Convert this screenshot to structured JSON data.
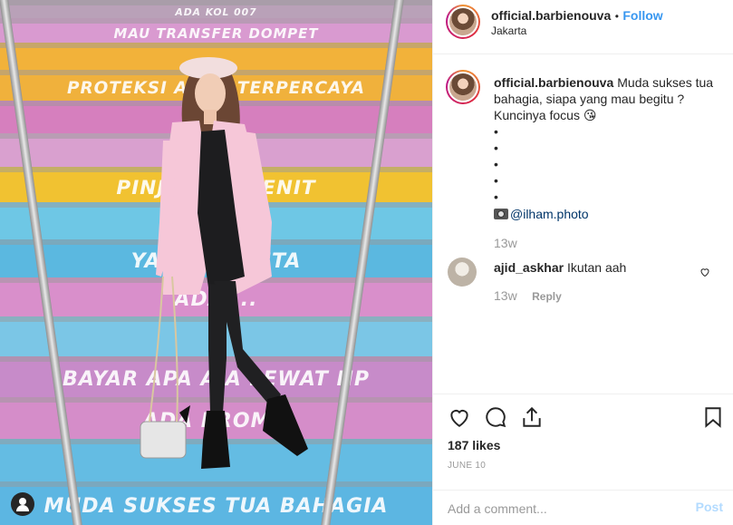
{
  "photo": {
    "step_texts": [
      "ADA KOL 007",
      "MAU TRANSFER DOMPET",
      "",
      "PROTEKSI AKUN TERPERCAYA",
      "",
      "",
      "PINJAM ... MENIT",
      "",
      "YANG P... KITA",
      "ADA ...",
      "",
      "BAYAR APA AJA LEWAT HP",
      "ADA PROMO",
      "",
      "MUDA SUKSES TUA BAHAGIA"
    ],
    "step_colors": [
      "#b9a1b8",
      "#d99ad0",
      "#f2b23a",
      "#f0b13c",
      "#d67fbe",
      "#d9a0cf",
      "#f1c231",
      "#6ec7e5",
      "#5bb8e0",
      "#d98fcb",
      "#7bc6e6",
      "#c78bc9",
      "#d58dc9",
      "#64bce3",
      "#5cb6e2"
    ]
  },
  "header": {
    "username": "official.barbienouva",
    "separator": "•",
    "follow_label": "Follow",
    "location": "Jakarta"
  },
  "caption": {
    "username": "official.barbienouva",
    "text": "Muda sukses tua bahagia, siapa yang mau begitu ? Kuncinya focus 😘",
    "bullets": [
      "•",
      "•",
      "•",
      "•",
      "•"
    ],
    "photo_credit": "@ilham.photo",
    "time": "13w"
  },
  "comment": {
    "username": "ajid_askhar",
    "text": "Ikutan aah",
    "time": "13w",
    "reply_label": "Reply"
  },
  "actions": {
    "likes": "187 likes",
    "date": "JUNE 10"
  },
  "add_comment": {
    "placeholder": "Add a comment...",
    "post_label": "Post"
  },
  "colors": {
    "accent": "#3897f0",
    "secondary_text": "#999999",
    "border": "#efefef"
  },
  "icons": {
    "like": "heart-icon",
    "comment": "comment-icon",
    "share": "share-icon",
    "save": "bookmark-icon",
    "comment_like": "heart-icon",
    "credit": "camera-icon",
    "corner": "user-icon"
  }
}
